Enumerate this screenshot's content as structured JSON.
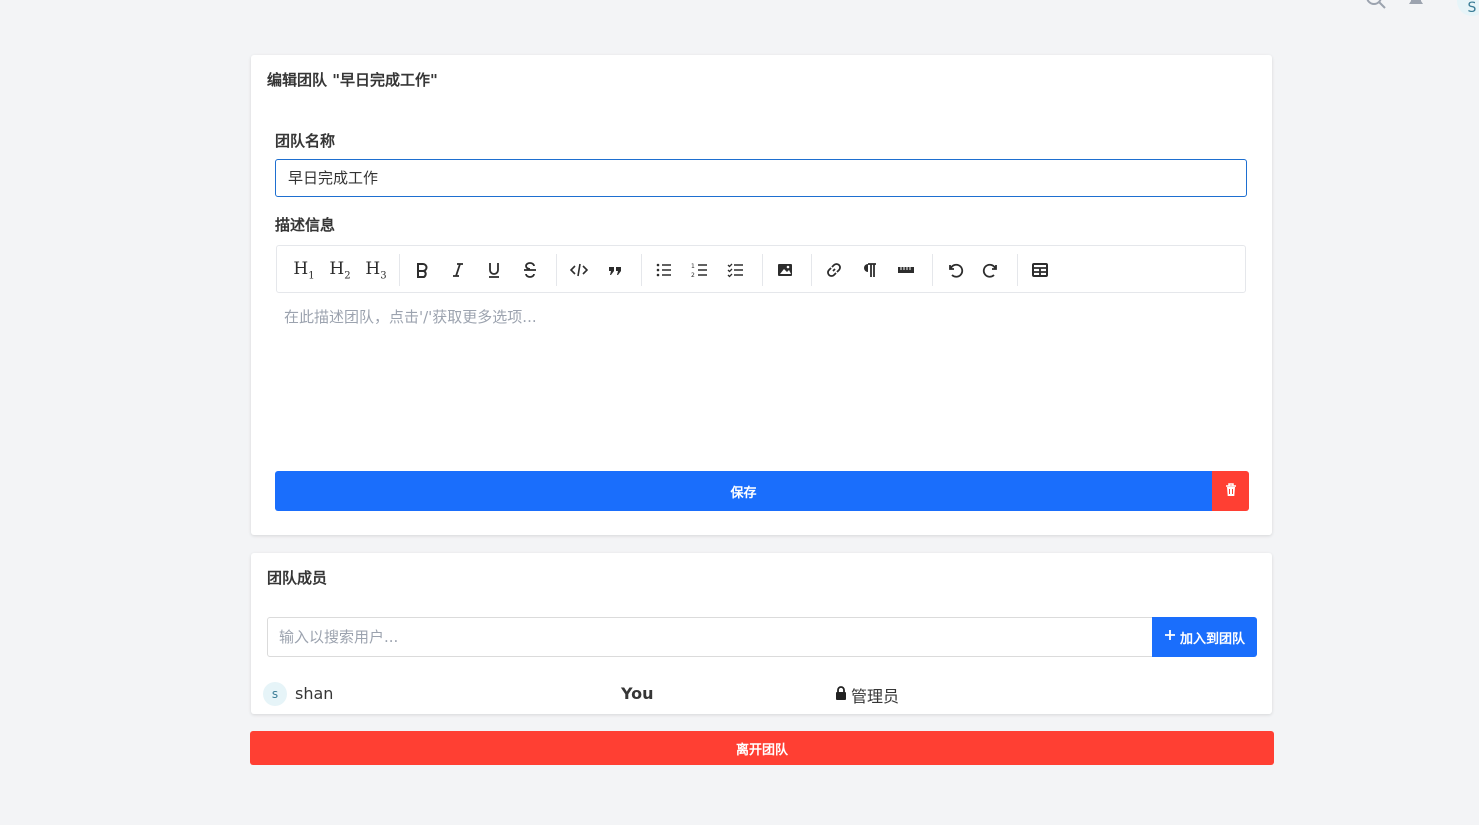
{
  "header": {
    "icons": [
      "search-icon",
      "bell-icon"
    ],
    "avatar_letter": "S"
  },
  "edit_card": {
    "title": "编辑团队 \"早日完成工作\"",
    "name_label": "团队名称",
    "name_value": "早日完成工作",
    "desc_label": "描述信息",
    "desc_placeholder": "在此描述团队，点击'/'获取更多选项...",
    "toolbar": [
      "heading-1-icon",
      "heading-2-icon",
      "heading-3-icon",
      "bold-icon",
      "italic-icon",
      "underline-icon",
      "strikethrough-icon",
      "code-icon",
      "quote-icon",
      "bullet-list-icon",
      "ordered-list-icon",
      "task-list-icon",
      "image-icon",
      "link-icon",
      "paragraph-icon",
      "horizontal-rule-icon",
      "undo-icon",
      "redo-icon",
      "table-icon"
    ],
    "save_label": "保存",
    "delete_icon": "trash-icon"
  },
  "members_card": {
    "title": "团队成员",
    "search_placeholder": "输入以搜索用户...",
    "add_label": "加入到团队",
    "members": [
      {
        "initial": "s",
        "name": "shan",
        "tag": "You",
        "role": "管理员",
        "role_icon": "lock-icon"
      }
    ]
  },
  "leave_label": "离开团队",
  "colors": {
    "primary": "#1a6efc",
    "danger": "#ff3f33",
    "background": "#f3f4f6"
  }
}
